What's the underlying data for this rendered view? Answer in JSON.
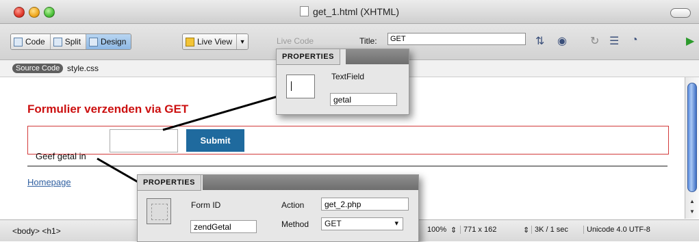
{
  "window": {
    "title": "get_1.html (XHTML)"
  },
  "toolbar": {
    "views": [
      {
        "label": "Code",
        "icon": "code-view-icon"
      },
      {
        "label": "Split",
        "icon": "split-view-icon"
      },
      {
        "label": "Design",
        "icon": "design-view-icon"
      }
    ],
    "live_view": "Live View",
    "live_code": "Live Code",
    "title_label": "Title:",
    "title_value": "GET"
  },
  "related_files": {
    "source_code": "Source Code",
    "css_file": "style.css"
  },
  "design": {
    "heading": "Formulier verzenden via GET",
    "label": "Geef getal in",
    "submit": "Submit",
    "link": "Homepage"
  },
  "props_textfield": {
    "tab": "PROPERTIES",
    "type": "TextField",
    "name": "getal"
  },
  "props_form": {
    "tab": "PROPERTIES",
    "form_id_label": "Form ID",
    "form_id": "zendGetal",
    "action_label": "Action",
    "action": "get_2.php",
    "method_label": "Method",
    "method": "GET"
  },
  "status": {
    "tag_selector": "<body> <h1>",
    "zoom": "100%",
    "window_size": "771 x 162",
    "download": "3K / 1 sec",
    "encoding": "Unicode 4.0 UTF-8"
  },
  "colors": {
    "heading": "#cc1010",
    "submit_bg": "#1f6a9e",
    "form_border": "#d23a3a",
    "link": "#2f5fa0"
  }
}
